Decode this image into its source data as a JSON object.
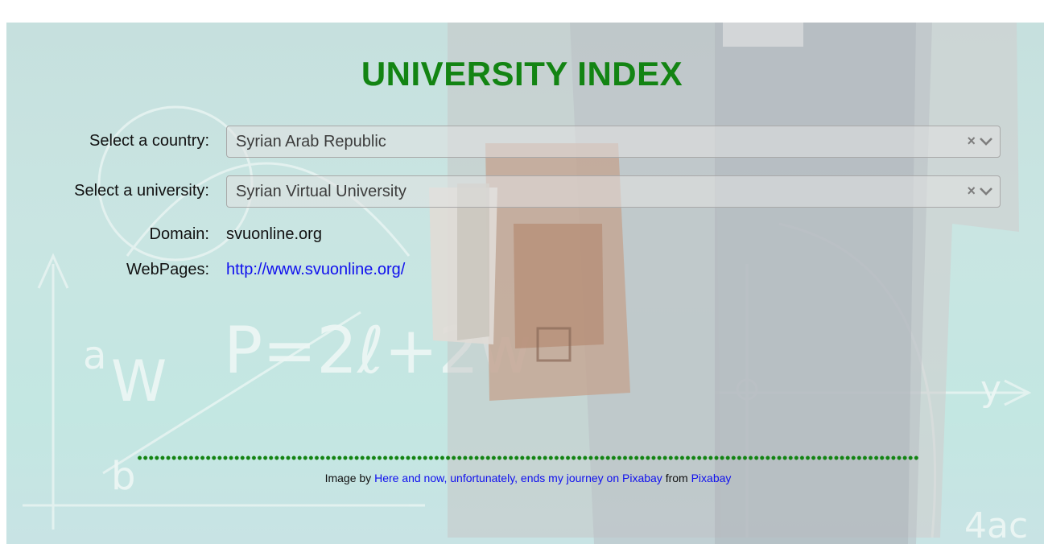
{
  "page": {
    "title": "UNIVERSITY INDEX",
    "accent_color": "#138413",
    "link_color": "#1010ee"
  },
  "form": {
    "country": {
      "label": "Select a country:",
      "value": "Syrian Arab Republic",
      "clear_icon": "×",
      "dropdown_icon": "chevron-down-icon"
    },
    "university": {
      "label": "Select a university:",
      "value": "Syrian Virtual University",
      "clear_icon": "×",
      "dropdown_icon": "chevron-down-icon"
    },
    "domain": {
      "label": "Domain:",
      "value": "svuonline.org"
    },
    "webpages": {
      "label": "WebPages:",
      "value": "http://www.svuonline.org/"
    }
  },
  "footer": {
    "prefix": "Image by",
    "author_link": "Here and now, unfortunately, ends my journey on Pixabay",
    "middle": "from",
    "source_link": "Pixabay"
  },
  "background": {
    "formula_text": "P=2ℓ+2w"
  }
}
